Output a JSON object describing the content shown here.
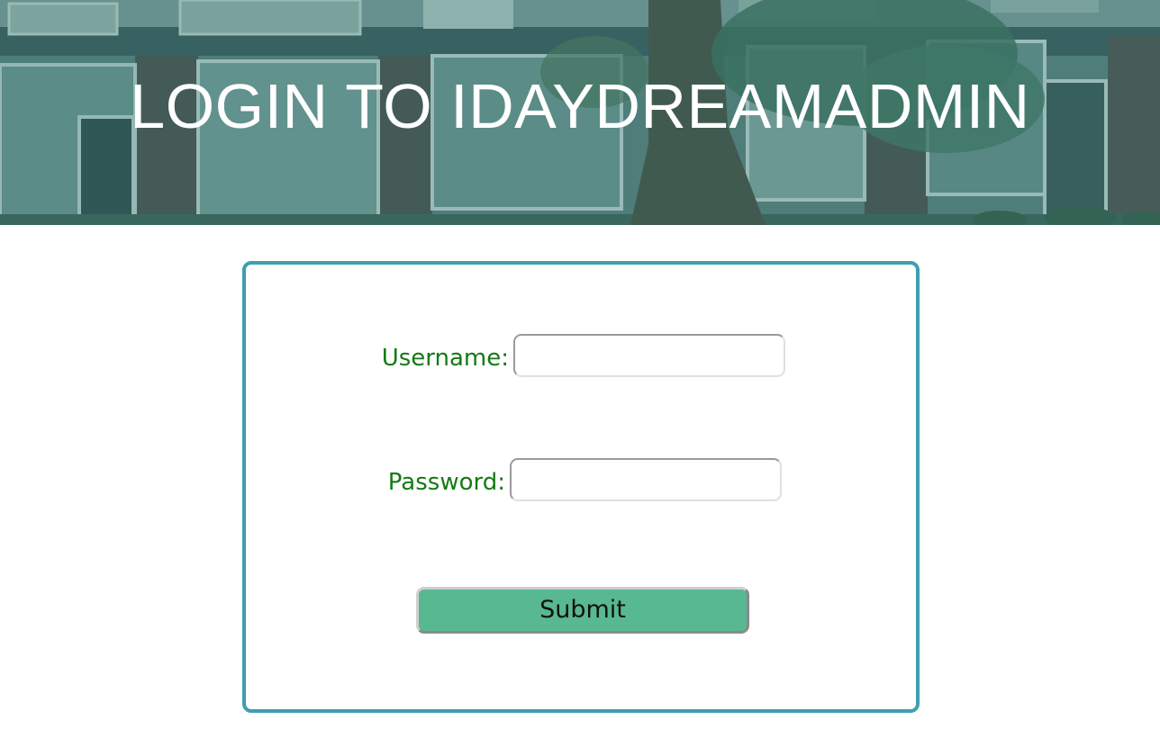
{
  "header": {
    "title": "LOGIN TO IDAYDREAMADMIN"
  },
  "form": {
    "username_label": "Username:",
    "username_value": "",
    "password_label": "Password:",
    "password_value": "",
    "submit_label": "Submit"
  },
  "colors": {
    "card_border": "#3f9faf",
    "label_text": "#147a14",
    "submit_background": "#58b891",
    "hero_tint": "#2e8080"
  }
}
